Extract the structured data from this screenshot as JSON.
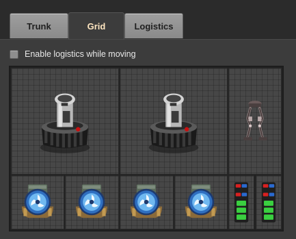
{
  "tabs": [
    {
      "label": "Trunk",
      "active": false
    },
    {
      "label": "Grid",
      "active": true
    },
    {
      "label": "Logistics",
      "active": false
    }
  ],
  "options": {
    "enable_logistics_label": "Enable logistics while moving",
    "enable_logistics_checked": false
  },
  "grid": {
    "large_items": [
      {
        "icon": "personal-roboport-icon"
      },
      {
        "icon": "personal-roboport-icon"
      },
      {
        "icon": "exoskeleton-icon"
      }
    ],
    "small_items": [
      {
        "icon": "fusion-reactor-icon"
      },
      {
        "icon": "fusion-reactor-icon"
      },
      {
        "icon": "fusion-reactor-icon"
      },
      {
        "icon": "fusion-reactor-icon"
      },
      {
        "icon": "battery-mk2-icon"
      },
      {
        "icon": "battery-mk2-icon"
      }
    ]
  },
  "colors": {
    "active_tab_text": "#ffe6c0",
    "inactive_tab_bg": "#9a9a9a",
    "panel_bg": "#3c3c3c",
    "slot_bg": "#474747"
  }
}
